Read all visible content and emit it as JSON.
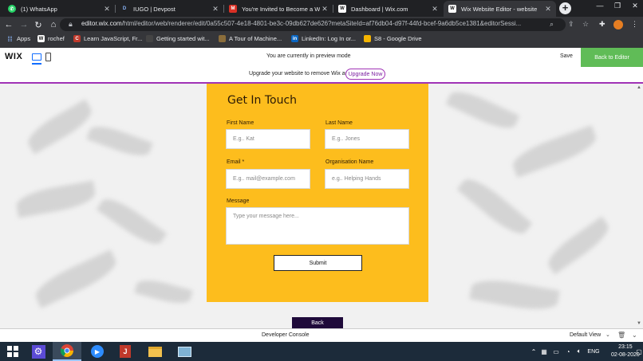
{
  "browser": {
    "tabs": [
      {
        "title": "(1) WhatsApp",
        "icon": "whatsapp-icon",
        "color": "#25d366",
        "glyph": "w",
        "active": false
      },
      {
        "title": "IUGO | Devpost",
        "icon": "devpost-icon",
        "color": "#003e54",
        "glyph": "D",
        "active": false
      },
      {
        "title": "You're Invited to Become a Wel",
        "icon": "gmail-icon",
        "color": "#d93025",
        "glyph": "M",
        "active": false
      },
      {
        "title": "Dashboard | Wix.com",
        "icon": "wix-icon",
        "color": "#fff",
        "glyph": "W",
        "active": false
      },
      {
        "title": "Wix Website Editor - website",
        "icon": "wix-icon",
        "color": "#fff",
        "glyph": "W",
        "active": true
      }
    ],
    "new_tab": "+",
    "url_host": "editor.wix.com",
    "url_rest": "/html/editor/web/renderer/edit/0a55c507-4e18-4801-be3c-09db627de626?metaSiteId=af76db04-d97f-44fd-bcef-9a6db5ce1381&editorSessi...",
    "bookmarks": [
      {
        "label": "Apps",
        "icon": "apps-grid-icon",
        "color": "#4285f4"
      },
      {
        "label": "rochef",
        "icon": "wix-icon",
        "color": "#111"
      },
      {
        "label": "Learn JavaScript, Fr...",
        "icon": "codecademy-icon",
        "color": "#c0392b"
      },
      {
        "label": "Getting started wit...",
        "icon": "bookmark-icon",
        "color": "#444"
      },
      {
        "label": "A Tour of Machine...",
        "icon": "image-icon",
        "color": "#8a6d3b"
      },
      {
        "label": "LinkedIn: Log In or...",
        "icon": "linkedin-icon",
        "color": "#0a66c2"
      },
      {
        "label": "S8 - Google Drive",
        "icon": "google-drive-icon",
        "color": "#f4b400"
      }
    ]
  },
  "wix": {
    "logo": "WIX",
    "preview_text": "You are currently in preview mode",
    "save_label": "Save",
    "back_to_editor": "Back to Editor",
    "upgrade_text": "Upgrade your website to remove Wix ads",
    "upgrade_button": "Upgrade Now",
    "dev_console": "Developer Console",
    "default_view": "Default View"
  },
  "form": {
    "title": "Get In Touch",
    "first_name_label": "First Name",
    "first_name_placeholder": "E.g.. Kat",
    "last_name_label": "Last Name",
    "last_name_placeholder": "E.g.. Jones",
    "email_label": "Email *",
    "email_placeholder": "E.g.. mail@example.com",
    "org_label": "Organisation Name",
    "org_placeholder": "e.g.. Helping Hands",
    "message_label": "Message",
    "message_placeholder": "Type your message here...",
    "submit_label": "Submit",
    "back_label": "Back"
  },
  "colors": {
    "form_bg": "#fdbd1d",
    "accent_green": "#60bc57",
    "upgrade_purple": "#a033b6",
    "back_button_bg": "#1f0a3a",
    "taskbar_bg": "#1c2b3a"
  },
  "taskbar": {
    "apps": [
      "windows-start-icon",
      "settings-icon",
      "chrome-icon",
      "zoom-icon",
      "app-icon",
      "file-explorer-icon",
      "photos-icon"
    ],
    "language": "ENG",
    "time": "23:15",
    "date": "02-08-2020"
  }
}
